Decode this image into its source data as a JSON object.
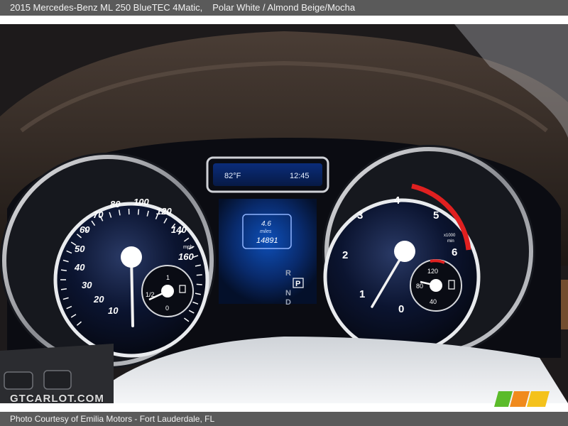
{
  "header": {
    "title": "2015 Mercedes-Benz ML 250 BlueTEC 4Matic,",
    "colors": "Polar White / Almond Beige/Mocha"
  },
  "footer": {
    "credit": "Photo Courtesy of Emilia Motors - Fort Lauderdale, FL"
  },
  "watermark": {
    "text": "GTCARLOT.COM"
  },
  "dashboard": {
    "display": {
      "temperature": "82°F",
      "time": "12:45",
      "trip": "4.6",
      "trip_unit": "miles",
      "odometer": "14891"
    },
    "gear_selector": {
      "r": "R",
      "n": "N",
      "d": "D",
      "p": "P"
    },
    "speedometer": {
      "ticks": [
        "10",
        "20",
        "30",
        "40",
        "50",
        "60",
        "70",
        "80",
        "100",
        "120",
        "140",
        "160"
      ],
      "unit": "mph"
    },
    "fuel_gauge": {
      "full": "1",
      "half": "1/2",
      "empty": "0"
    },
    "tachometer": {
      "ticks": [
        "1",
        "2",
        "3",
        "4",
        "5",
        "6"
      ],
      "zero": "0",
      "unit_top": "x1000",
      "unit_bottom": "min"
    },
    "coolant_gauge": {
      "high": "120",
      "mid": "80",
      "low": "40"
    }
  },
  "colors": {
    "bar": "#5a5a5a",
    "accent_blue": "#3aa0ff",
    "redline": "#e02020"
  }
}
